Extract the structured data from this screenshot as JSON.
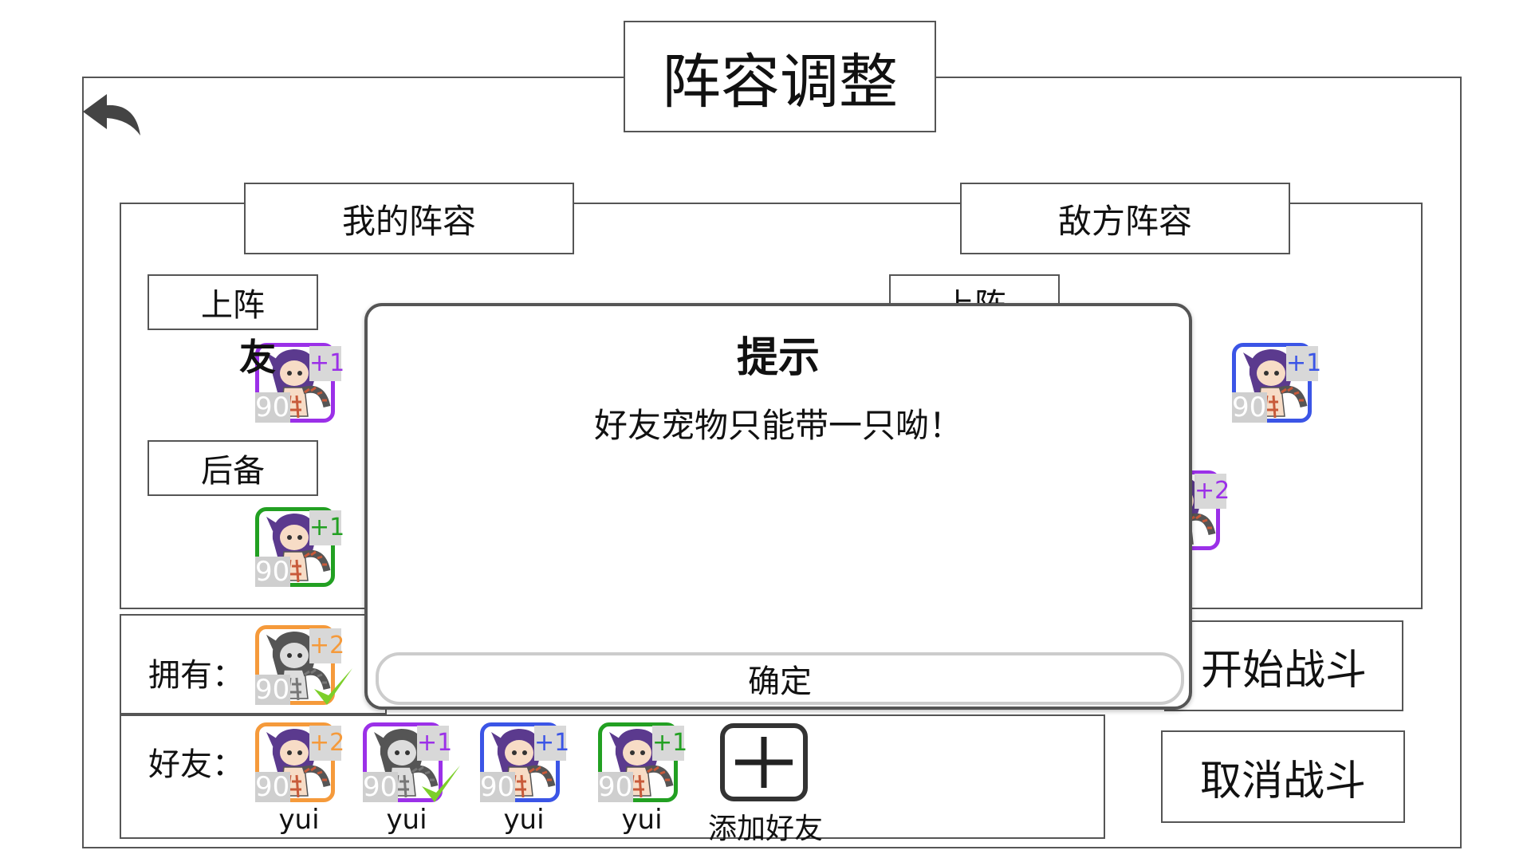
{
  "title": "阵容调整",
  "my_team": {
    "header": "我的阵容",
    "active_label": "上阵",
    "reserve_label": "后备",
    "friend_tag": "友"
  },
  "enemy_team": {
    "header": "敌方阵容",
    "active_label": "上阵"
  },
  "owned_label": "拥有：",
  "friends_label": "好友：",
  "add_friend_label": "添加好友",
  "buttons": {
    "start": "开始战斗",
    "cancel": "取消战斗"
  },
  "dialog": {
    "title": "提示",
    "message": "好友宠物只能带一只呦！",
    "confirm": "确定"
  },
  "colors": {
    "purple": "#9b30e8",
    "green": "#22a022",
    "orange": "#f59a3b",
    "blue": "#3b55e6",
    "check": "#7ccf2a"
  },
  "pets": {
    "my_active": {
      "level": "90",
      "plus": "+1",
      "color": "purple"
    },
    "my_reserve": {
      "level": "90",
      "plus": "+1",
      "color": "green"
    },
    "enemy_active": {
      "level": "90",
      "plus": "+1",
      "color": "blue"
    },
    "enemy_reserve": {
      "plus": "+2",
      "color": "purple"
    },
    "owned": [
      {
        "level": "90",
        "plus": "+2",
        "color": "orange",
        "grayscale": true,
        "checked": true
      }
    ],
    "friends": [
      {
        "level": "90",
        "plus": "+2",
        "color": "orange",
        "name": "yui",
        "grayscale": false,
        "checked": false
      },
      {
        "level": "90",
        "plus": "+1",
        "color": "purple",
        "name": "yui",
        "grayscale": true,
        "checked": true
      },
      {
        "level": "90",
        "plus": "+1",
        "color": "blue",
        "name": "yui",
        "grayscale": false,
        "checked": false
      },
      {
        "level": "90",
        "plus": "+1",
        "color": "green",
        "name": "yui",
        "grayscale": false,
        "checked": false
      }
    ]
  }
}
